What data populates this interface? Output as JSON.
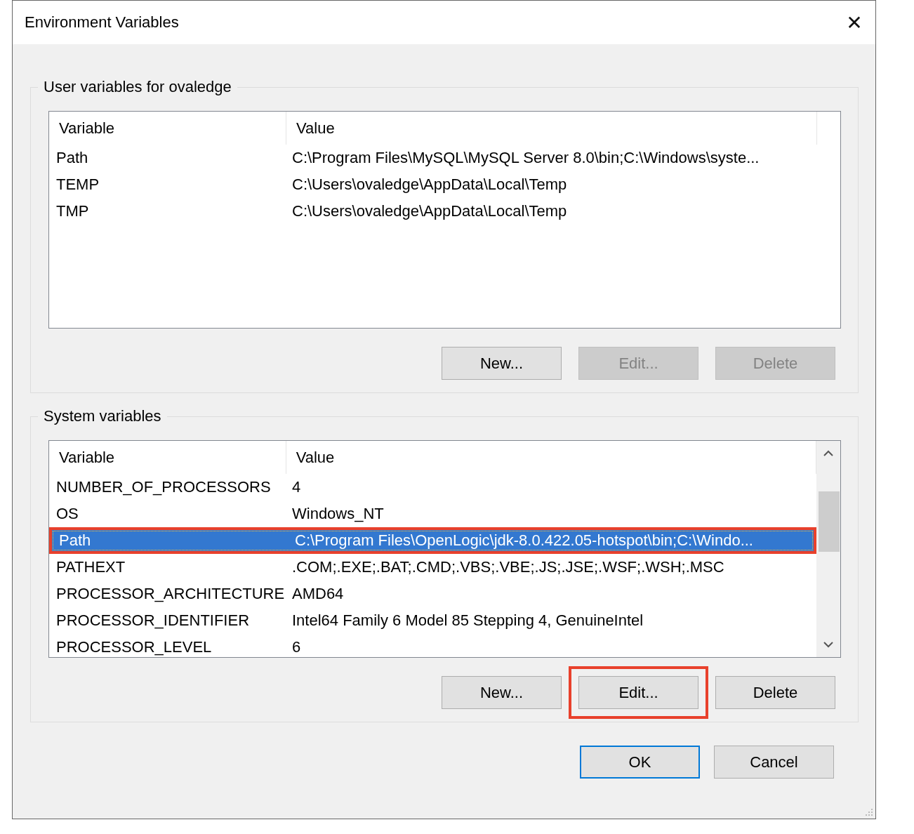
{
  "window": {
    "title": "Environment Variables",
    "close": "✕"
  },
  "groups": [
    {
      "title": "User variables for ovaledge",
      "columns": [
        "Variable",
        "Value"
      ],
      "scrollbar": false,
      "rows": [
        {
          "variable": "Path",
          "value": "C:\\Program Files\\MySQL\\MySQL Server 8.0\\bin;C:\\Windows\\syste...",
          "selected": false,
          "highlighted": false
        },
        {
          "variable": "TEMP",
          "value": "C:\\Users\\ovaledge\\AppData\\Local\\Temp",
          "selected": false,
          "highlighted": false
        },
        {
          "variable": "TMP",
          "value": "C:\\Users\\ovaledge\\AppData\\Local\\Temp",
          "selected": false,
          "highlighted": false
        }
      ],
      "buttons": [
        {
          "label": "New...",
          "disabled": false,
          "highlighted": false
        },
        {
          "label": "Edit...",
          "disabled": true,
          "highlighted": false
        },
        {
          "label": "Delete",
          "disabled": true,
          "highlighted": false
        }
      ]
    },
    {
      "title": "System variables",
      "columns": [
        "Variable",
        "Value"
      ],
      "scrollbar": true,
      "rows": [
        {
          "variable": "NUMBER_OF_PROCESSORS",
          "value": "4",
          "selected": false,
          "highlighted": false
        },
        {
          "variable": "OS",
          "value": "Windows_NT",
          "selected": false,
          "highlighted": false
        },
        {
          "variable": "Path",
          "value": "C:\\Program Files\\OpenLogic\\jdk-8.0.422.05-hotspot\\bin;C:\\Windo...",
          "selected": true,
          "highlighted": true
        },
        {
          "variable": "PATHEXT",
          "value": ".COM;.EXE;.BAT;.CMD;.VBS;.VBE;.JS;.JSE;.WSF;.WSH;.MSC",
          "selected": false,
          "highlighted": false
        },
        {
          "variable": "PROCESSOR_ARCHITECTURE",
          "value": "AMD64",
          "selected": false,
          "highlighted": false
        },
        {
          "variable": "PROCESSOR_IDENTIFIER",
          "value": "Intel64 Family 6 Model 85 Stepping 4, GenuineIntel",
          "selected": false,
          "highlighted": false
        },
        {
          "variable": "PROCESSOR_LEVEL",
          "value": "6",
          "selected": false,
          "highlighted": false
        }
      ],
      "buttons": [
        {
          "label": "New...",
          "disabled": false,
          "highlighted": false
        },
        {
          "label": "Edit...",
          "disabled": false,
          "highlighted": true
        },
        {
          "label": "Delete",
          "disabled": false,
          "highlighted": false
        }
      ]
    }
  ],
  "footer_buttons": [
    {
      "label": "OK",
      "default": true
    },
    {
      "label": "Cancel",
      "default": false
    }
  ]
}
